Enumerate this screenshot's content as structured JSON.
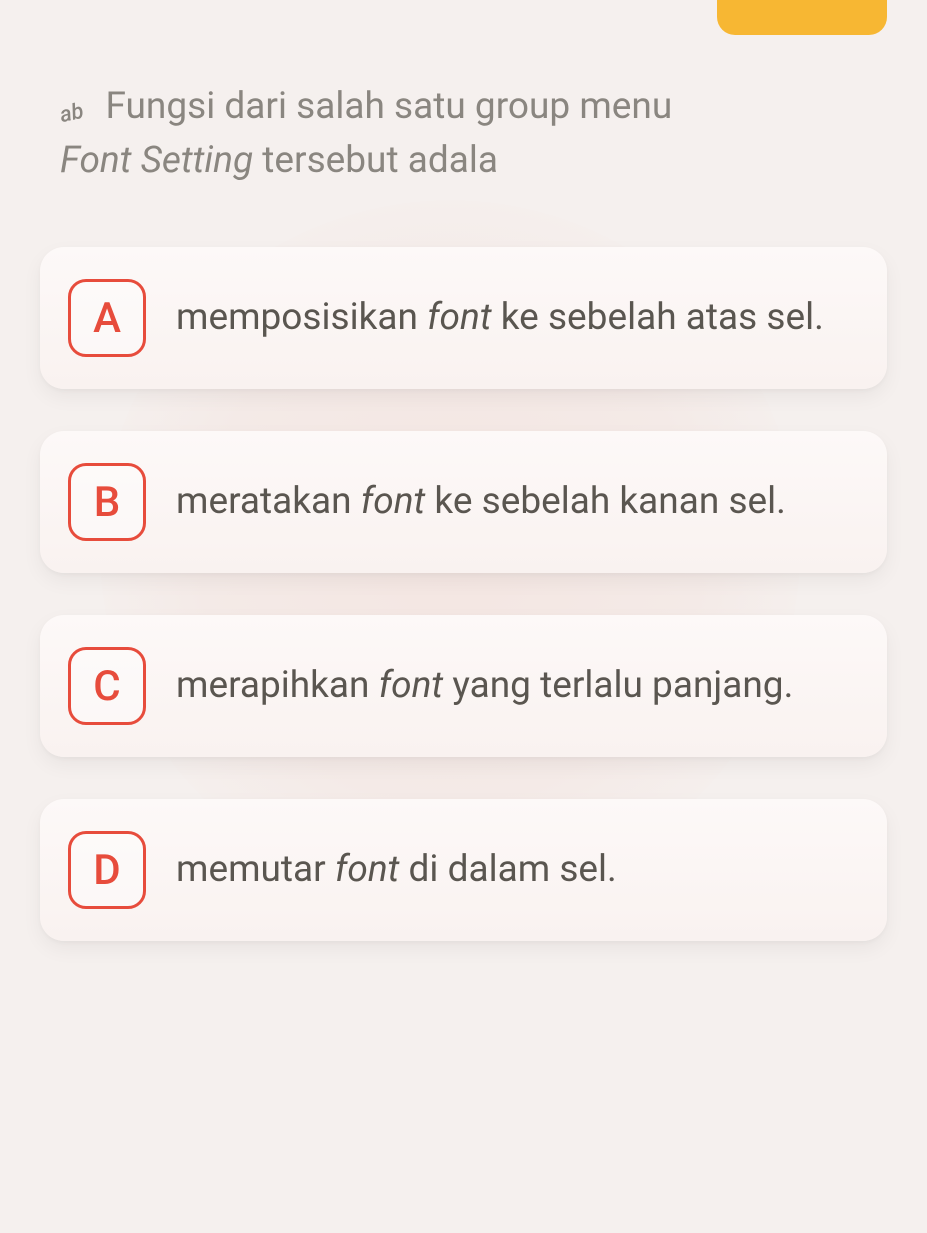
{
  "question": {
    "icon_label": "ab",
    "line1": "Fungsi dari salah satu group menu",
    "line2_italic": "Font Setting",
    "line2_rest": " tersebut adala"
  },
  "options": [
    {
      "letter": "A",
      "pre": "memposisikan ",
      "italic": "font",
      "post": " ke sebelah atas sel."
    },
    {
      "letter": "B",
      "pre": "meratakan ",
      "italic": "font",
      "post": " ke sebelah kanan sel."
    },
    {
      "letter": "C",
      "pre": "merapihkan ",
      "italic": "font",
      "post": " yang terlalu panjang."
    },
    {
      "letter": "D",
      "pre": "memutar ",
      "italic": "font",
      "post": " di dalam sel."
    }
  ]
}
